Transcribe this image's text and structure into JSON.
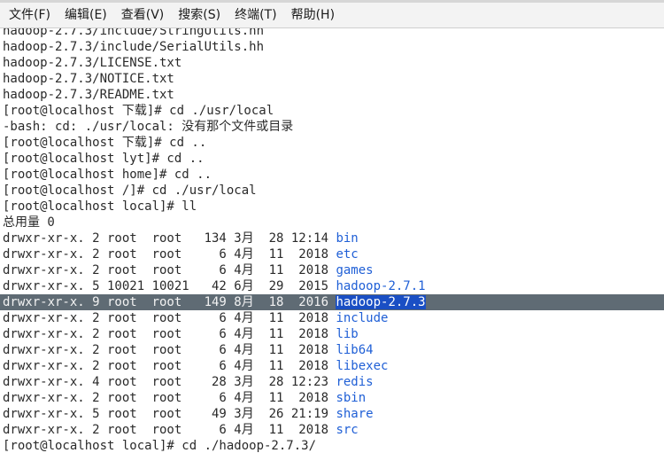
{
  "menu": [
    "文件(F)",
    "编辑(E)",
    "查看(V)",
    "搜索(S)",
    "终端(T)",
    "帮助(H)"
  ],
  "terminal": {
    "top_lines": [
      "hadoop-2.7.3/include/StringUtils.hh",
      "hadoop-2.7.3/include/SerialUtils.hh",
      "hadoop-2.7.3/LICENSE.txt",
      "hadoop-2.7.3/NOTICE.txt",
      "hadoop-2.7.3/README.txt",
      "[root@localhost 下载]# cd ./usr/local",
      "-bash: cd: ./usr/local: 没有那个文件或目录",
      "[root@localhost 下载]# cd ..",
      "[root@localhost lyt]# cd ..",
      "[root@localhost home]# cd ..",
      "[root@localhost /]# cd ./usr/local",
      "[root@localhost local]# ll",
      "总用量 0"
    ],
    "listing": [
      {
        "perm": "drwxr-xr-x.",
        "links": "2",
        "owner": "root",
        "group": "root",
        "size": "134",
        "month": "3月",
        "day": "28",
        "time": "12:14",
        "name": "bin"
      },
      {
        "perm": "drwxr-xr-x.",
        "links": "2",
        "owner": "root",
        "group": "root",
        "size": "6",
        "month": "4月",
        "day": "11",
        "time": "2018",
        "name": "etc"
      },
      {
        "perm": "drwxr-xr-x.",
        "links": "2",
        "owner": "root",
        "group": "root",
        "size": "6",
        "month": "4月",
        "day": "11",
        "time": "2018",
        "name": "games"
      },
      {
        "perm": "drwxr-xr-x.",
        "links": "5",
        "owner": "10021",
        "group": "10021",
        "size": "42",
        "month": "6月",
        "day": "29",
        "time": "2015",
        "name": "hadoop-2.7.1"
      },
      {
        "perm": "drwxr-xr-x.",
        "links": "9",
        "owner": "root",
        "group": "root",
        "size": "149",
        "month": "8月",
        "day": "18",
        "time": "2016",
        "name": "hadoop-2.7.3",
        "selected": true
      },
      {
        "perm": "drwxr-xr-x.",
        "links": "2",
        "owner": "root",
        "group": "root",
        "size": "6",
        "month": "4月",
        "day": "11",
        "time": "2018",
        "name": "include"
      },
      {
        "perm": "drwxr-xr-x.",
        "links": "2",
        "owner": "root",
        "group": "root",
        "size": "6",
        "month": "4月",
        "day": "11",
        "time": "2018",
        "name": "lib"
      },
      {
        "perm": "drwxr-xr-x.",
        "links": "2",
        "owner": "root",
        "group": "root",
        "size": "6",
        "month": "4月",
        "day": "11",
        "time": "2018",
        "name": "lib64"
      },
      {
        "perm": "drwxr-xr-x.",
        "links": "2",
        "owner": "root",
        "group": "root",
        "size": "6",
        "month": "4月",
        "day": "11",
        "time": "2018",
        "name": "libexec"
      },
      {
        "perm": "drwxr-xr-x.",
        "links": "4",
        "owner": "root",
        "group": "root",
        "size": "28",
        "month": "3月",
        "day": "28",
        "time": "12:23",
        "name": "redis"
      },
      {
        "perm": "drwxr-xr-x.",
        "links": "2",
        "owner": "root",
        "group": "root",
        "size": "6",
        "month": "4月",
        "day": "11",
        "time": "2018",
        "name": "sbin"
      },
      {
        "perm": "drwxr-xr-x.",
        "links": "5",
        "owner": "root",
        "group": "root",
        "size": "49",
        "month": "3月",
        "day": "26",
        "time": "21:19",
        "name": "share"
      },
      {
        "perm": "drwxr-xr-x.",
        "links": "2",
        "owner": "root",
        "group": "root",
        "size": "6",
        "month": "4月",
        "day": "11",
        "time": "2018",
        "name": "src"
      }
    ],
    "last_line": "[root@localhost local]# cd ./hadoop-2.7.3/"
  }
}
